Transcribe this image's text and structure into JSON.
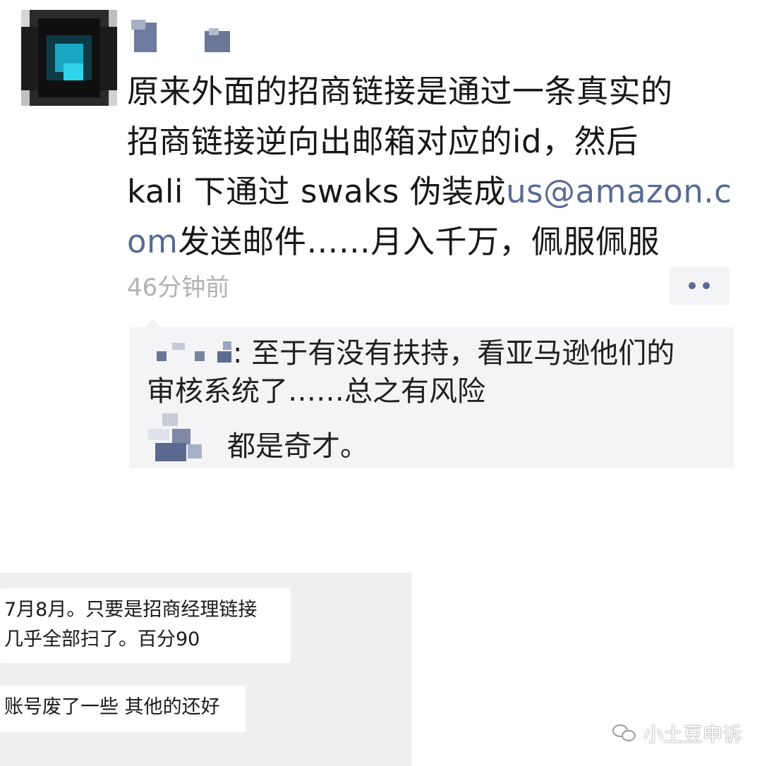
{
  "post": {
    "text_line1": "原来外面的招商链接是通过一条真实的",
    "text_line2": "招商链接逆向出邮箱对应的id，然后",
    "text_line3_prefix": "kali 下通过 swaks 伪装成",
    "email_part1": "us@amazon.c",
    "email_part2": "om",
    "text_line4_suffix": "发送邮件……月入千万，佩服佩服",
    "time": "46分钟前",
    "colors": {
      "link": "#576b95",
      "time": "#b2b2b2",
      "comment_bg": "#f4f4f6"
    }
  },
  "comments": {
    "first_text_line1": ": 至于有没有扶持，看亚马逊他们的",
    "first_text_line2": "审核系统了……总之有风险",
    "second_text": "都是奇才。"
  },
  "chat": {
    "message1_line1": "7月8月。只要是招商经理链接",
    "message1_line2": "几乎全部扫了。百分90",
    "message2": "账号废了一些 其他的还好"
  },
  "watermark": {
    "text": "小土豆申诉",
    "icon": "wechat-logo-icon"
  }
}
